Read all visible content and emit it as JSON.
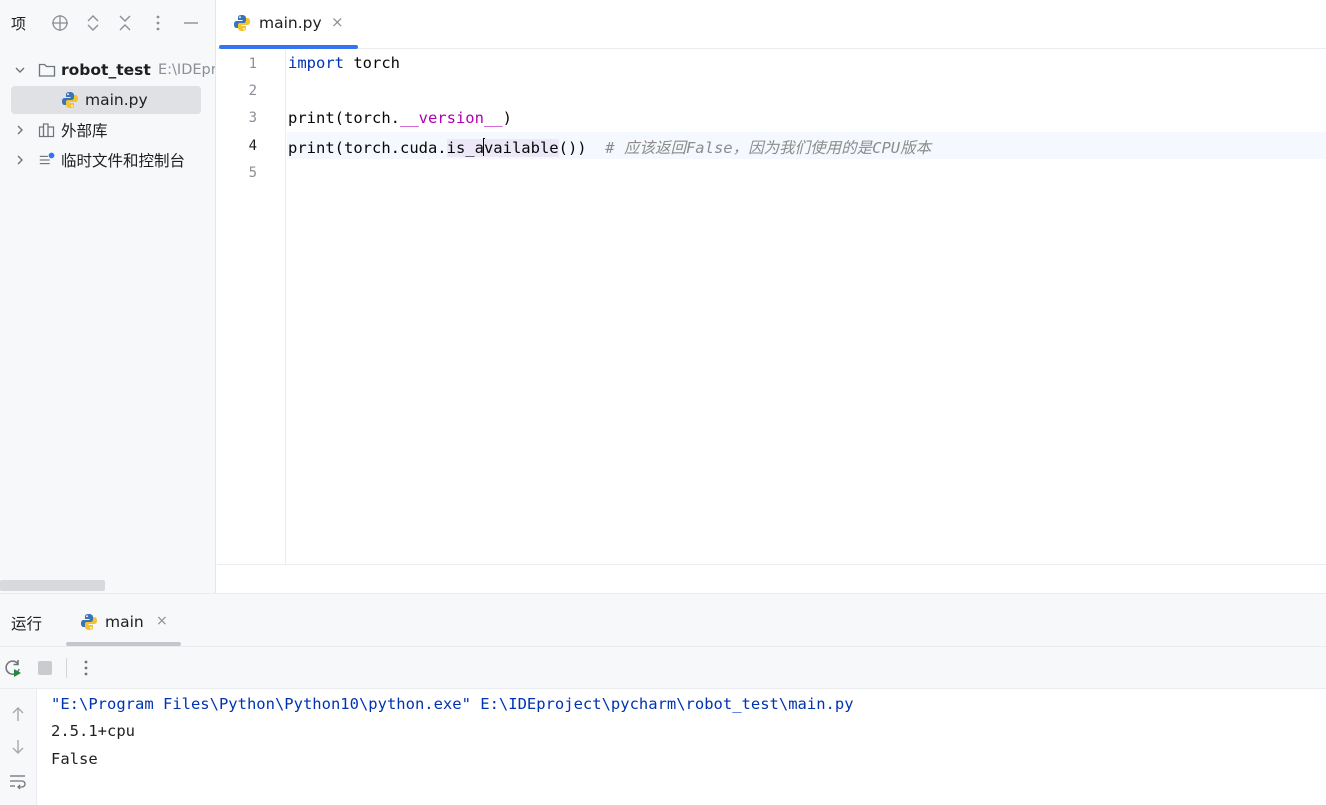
{
  "sidebar": {
    "title": "项",
    "tree": [
      {
        "label": "robot_test",
        "hint": "E:\\IDEproject\\pycharm\\robot_test",
        "icon": "folder-icon",
        "expanded": true
      },
      {
        "label": "main.py",
        "icon": "python-file-icon",
        "selected": true
      },
      {
        "label": "外部库",
        "icon": "library-icon",
        "expanded": false
      },
      {
        "label": "临时文件和控制台",
        "icon": "scratches-icon",
        "expanded": false
      }
    ]
  },
  "editor": {
    "tab": {
      "label": "main.py",
      "close": "×"
    },
    "line_numbers": [
      "1",
      "2",
      "3",
      "4",
      "5"
    ],
    "current_line": 4,
    "lines": {
      "l1": {
        "kw": "import",
        "rest": " torch"
      },
      "l3": {
        "a": "print(torch.",
        "dunder": "__version__",
        "b": ")"
      },
      "l4": {
        "a": "print(torch.cuda.",
        "hl1": "is_a",
        "hl2": "vailable",
        "b": "())",
        "comment": "# 应该返回False，因为我们使用的是CPU版本"
      }
    }
  },
  "run": {
    "title": "运行",
    "tab": {
      "label": "main",
      "close": "×"
    },
    "output": [
      {
        "text": "\"E:\\Program Files\\Python\\Python10\\python.exe\" E:\\IDEproject\\pycharm\\robot_test\\main.py",
        "kind": "command"
      },
      {
        "text": "2.5.1+cpu",
        "kind": "stdout"
      },
      {
        "text": "False",
        "kind": "stdout"
      }
    ]
  },
  "colors": {
    "accent": "#3574f0",
    "keyword": "#0033b3",
    "dunder": "#b200b2",
    "comment": "#8c8c8c"
  }
}
